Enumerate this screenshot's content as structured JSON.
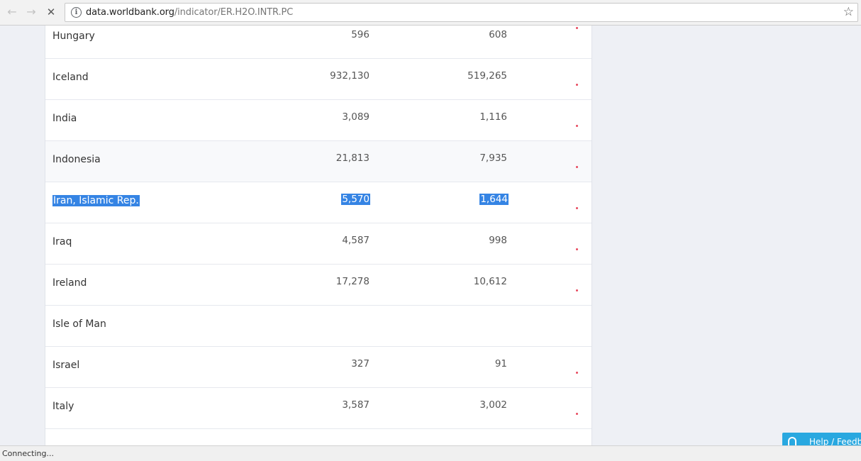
{
  "browser": {
    "url_host": "data.worldbank.org",
    "url_path": "/indicator/ER.H2O.INTR.PC",
    "status_text": "Connecting..."
  },
  "table": {
    "rows": [
      {
        "country": "Hungary",
        "v1": "596",
        "v2": "608"
      },
      {
        "country": "Iceland",
        "v1": "932,130",
        "v2": "519,265"
      },
      {
        "country": "India",
        "v1": "3,089",
        "v2": "1,116"
      },
      {
        "country": "Indonesia",
        "v1": "21,813",
        "v2": "7,935"
      },
      {
        "country": "Iran, Islamic Rep.",
        "v1": "5,570",
        "v2": "1,644"
      },
      {
        "country": "Iraq",
        "v1": "4,587",
        "v2": "998"
      },
      {
        "country": "Ireland",
        "v1": "17,278",
        "v2": "10,612"
      },
      {
        "country": "Isle of Man",
        "v1": "",
        "v2": ""
      },
      {
        "country": "Israel",
        "v1": "327",
        "v2": "91"
      },
      {
        "country": "Italy",
        "v1": "3,587",
        "v2": "3,002"
      }
    ]
  },
  "feedback": {
    "label": "Help / Feedb"
  },
  "colors": {
    "selection": "#3584e4",
    "sparkline_dot": "#e84a5f",
    "feedback_bg": "#29a8e0"
  }
}
